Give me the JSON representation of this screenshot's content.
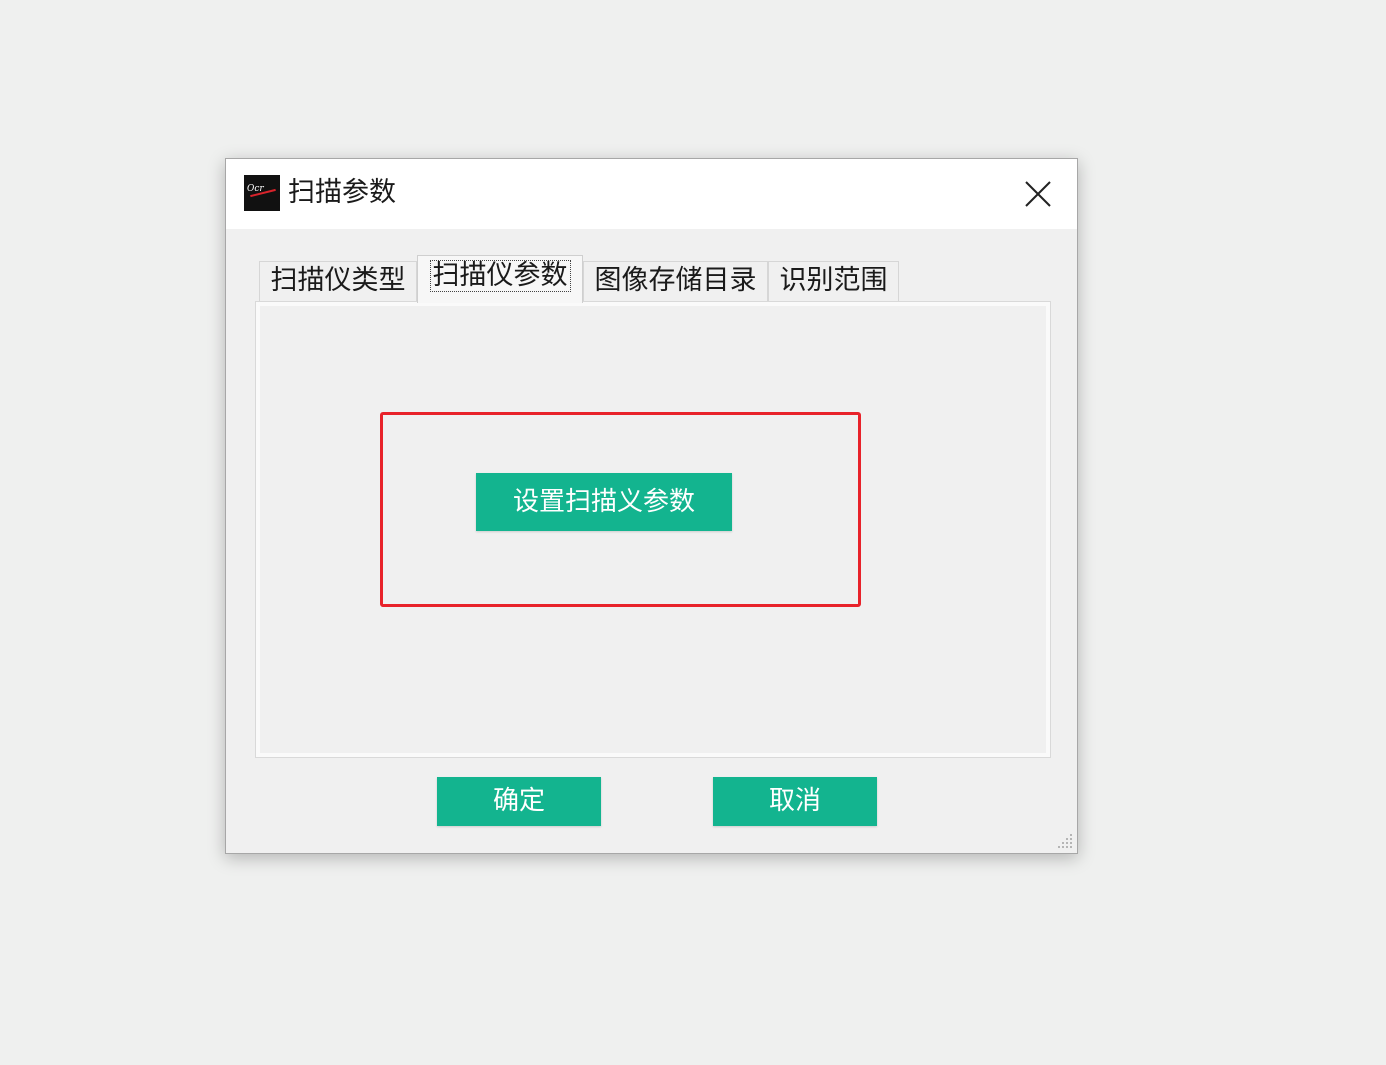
{
  "window": {
    "title": "扫描参数",
    "logo_text": "Ocr"
  },
  "tabs": [
    {
      "label": "扫描仪类型",
      "active": false
    },
    {
      "label": "扫描仪参数",
      "active": true
    },
    {
      "label": "图像存储目录",
      "active": false
    },
    {
      "label": "识别范围",
      "active": false
    }
  ],
  "panel": {
    "set_params_label": "设置扫描义参数"
  },
  "footer": {
    "ok_label": "确定",
    "cancel_label": "取消"
  },
  "colors": {
    "accent_green": "#13b48f",
    "highlight_red": "#e8222a"
  },
  "icons": {
    "app": "app-logo-icon",
    "close": "close-icon",
    "resize": "resize-grip-icon"
  }
}
